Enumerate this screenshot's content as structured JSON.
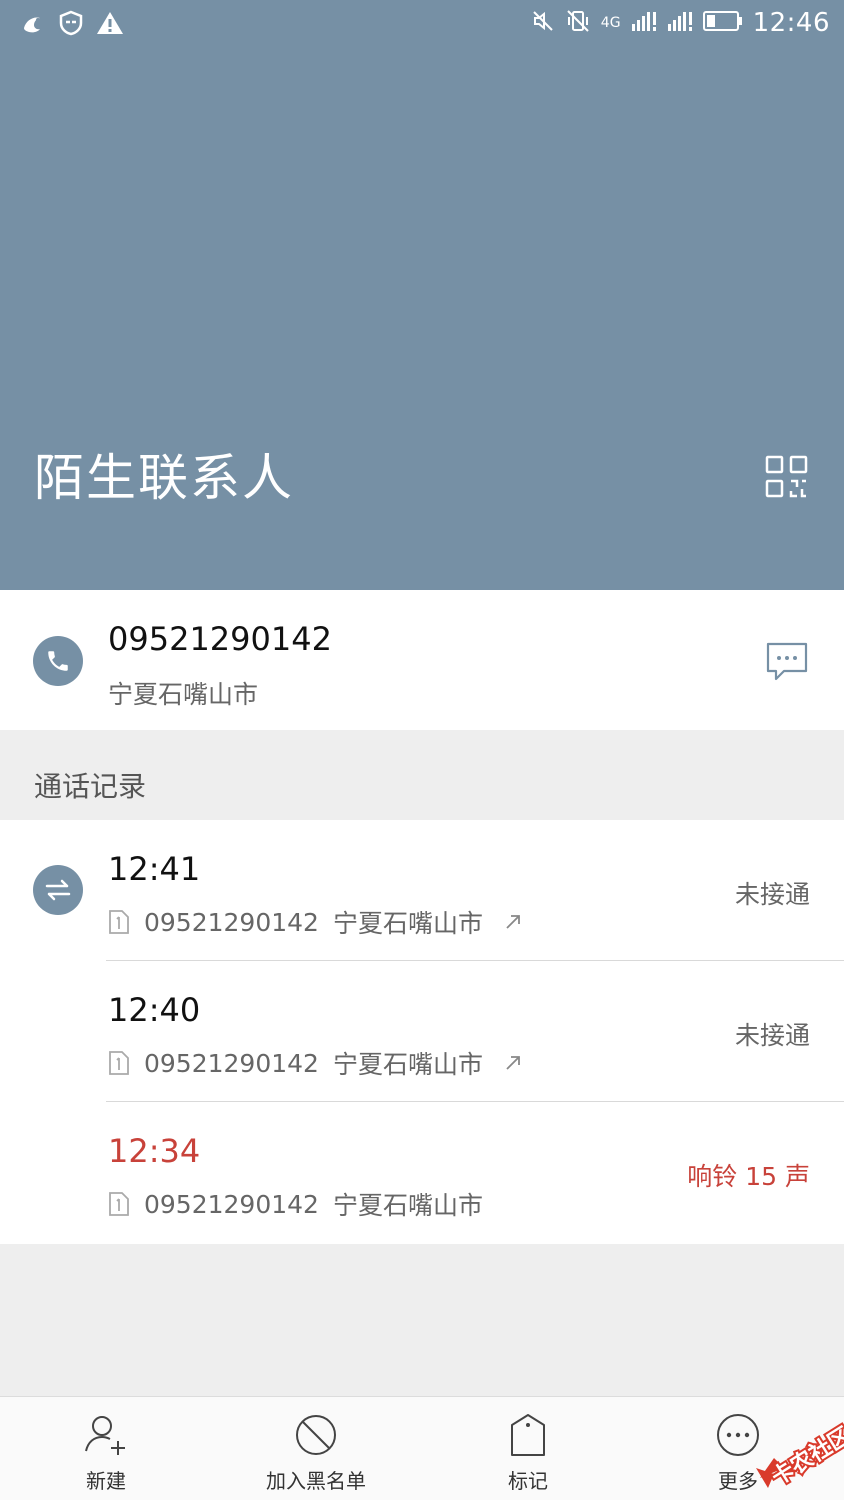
{
  "status_bar": {
    "time": "12:46",
    "network": "4G",
    "icons": [
      "uc-browser-icon",
      "shield-icon",
      "warning-icon",
      "mute-icon",
      "vibrate-off-icon",
      "signal-icon",
      "signal-icon",
      "battery-icon"
    ]
  },
  "header": {
    "title": "陌生联系人",
    "bg_color": "#7690a5"
  },
  "number": {
    "value": "09521290142",
    "location": "宁夏石嘴山市"
  },
  "call_log": {
    "section_title": "通话记录",
    "entries": [
      {
        "time": "12:41",
        "number": "09521290142",
        "location": "宁夏石嘴山市",
        "status": "未接通",
        "outgoing": true,
        "missed": false
      },
      {
        "time": "12:40",
        "number": "09521290142",
        "location": "宁夏石嘴山市",
        "status": "未接通",
        "outgoing": true,
        "missed": false
      },
      {
        "time": "12:34",
        "number": "09521290142",
        "location": "宁夏石嘴山市",
        "status": "响铃 15 声",
        "outgoing": false,
        "missed": true
      }
    ]
  },
  "bottom_bar": {
    "items": [
      {
        "label": "新建",
        "icon": "add-contact-icon"
      },
      {
        "label": "加入黑名单",
        "icon": "block-icon"
      },
      {
        "label": "标记",
        "icon": "tag-icon"
      },
      {
        "label": "更多",
        "icon": "more-icon"
      }
    ]
  },
  "watermark": {
    "text": "卡农社区"
  },
  "colors": {
    "accent": "#7690a5",
    "missed": "#c8423a"
  }
}
